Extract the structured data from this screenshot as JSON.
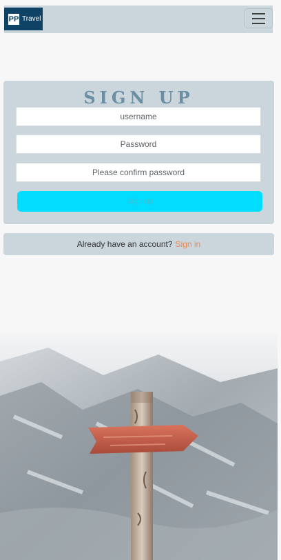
{
  "navbar": {
    "brand_mark": "PP",
    "brand_word": "Travel"
  },
  "form": {
    "title": "SIGN UP",
    "username_placeholder": "username",
    "password_placeholder": "Password",
    "confirm_placeholder": "Please confirm password",
    "submit_label": "Sign up"
  },
  "footer": {
    "prompt": "Already have an account?",
    "link": "Sign in"
  },
  "colors": {
    "navbar_bg": "#cad6dc",
    "brand_bg": "#0f4366",
    "submit_bg": "#00ddff",
    "link": "#f08650",
    "title": "#6c8fa4"
  },
  "icons": {
    "menu": "hamburger-icon"
  }
}
